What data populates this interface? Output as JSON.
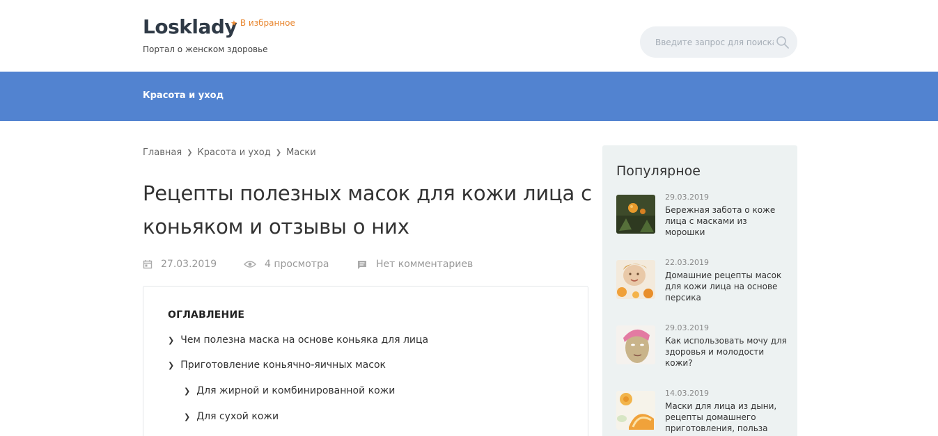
{
  "header": {
    "logo": "Losklady",
    "favorites_label": "В избранное",
    "tagline": "Портал о женском здоровье",
    "search_placeholder": "Введите запрос для поиска"
  },
  "nav": {
    "items": [
      {
        "label": "Красота и уход"
      }
    ]
  },
  "breadcrumb": {
    "items": [
      {
        "label": "Главная"
      },
      {
        "label": "Красота и уход"
      },
      {
        "label": "Маски"
      }
    ]
  },
  "article": {
    "title": "Рецепты полезных масок для кожи лица с коньяком и отзывы о них",
    "date": "27.03.2019",
    "views": "4 просмотра",
    "comments": "Нет комментариев"
  },
  "toc": {
    "title": "ОГЛАВЛЕНИЕ",
    "items": [
      {
        "label": "Чем полезна маска на основе коньяка для лица",
        "level": 1
      },
      {
        "label": "Приготовление коньячно-яичных масок",
        "level": 1
      },
      {
        "label": "Для жирной и комбинированной кожи",
        "level": 2
      },
      {
        "label": "Для сухой кожи",
        "level": 2
      }
    ]
  },
  "sidebar": {
    "title": "Популярное",
    "items": [
      {
        "date": "29.03.2019",
        "text": "Бережная забота о коже лица с масками из морошки"
      },
      {
        "date": "22.03.2019",
        "text": "Домашние рецепты масок для кожи лица на основе персика"
      },
      {
        "date": "29.03.2019",
        "text": "Как использовать мочу для здоровья и молодости кожи?"
      },
      {
        "date": "14.03.2019",
        "text": "Маски для лица из дыни, рецепты домашнего приготовления, польза"
      }
    ]
  },
  "colors": {
    "nav_bg": "#5283d0",
    "favorites": "#e8862f",
    "sidebar_bg": "#edf2f2"
  }
}
